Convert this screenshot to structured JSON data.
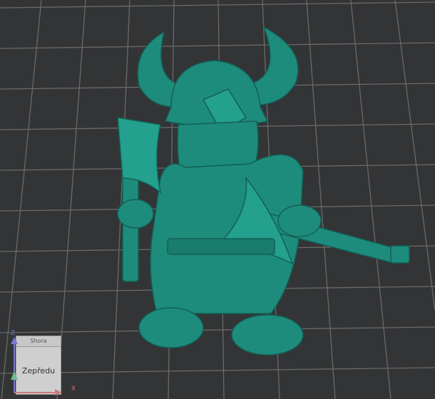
{
  "viewport": {
    "background": "#333436",
    "grid_color": "#6a6a6a",
    "model_color": "#1e8c7c"
  },
  "view_cube": {
    "top_face": "Shora",
    "front_face": "Zepředu",
    "axis_z": "Z",
    "axis_x": "X"
  }
}
